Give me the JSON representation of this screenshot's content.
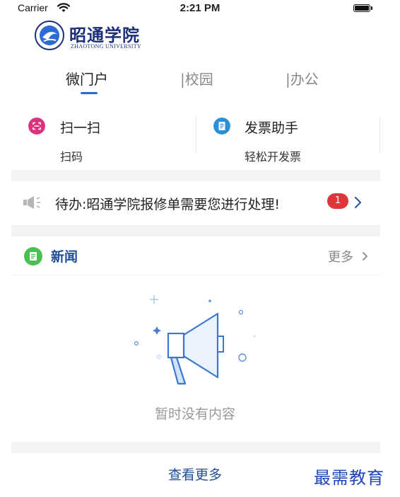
{
  "status_bar": {
    "carrier": "Carrier",
    "time": "2:21 PM"
  },
  "logo": {
    "name_cn": "昭通学院",
    "name_en": "ZHAOTONG UNIVERSITY"
  },
  "tabs": [
    {
      "label": "微门户",
      "active": true
    },
    {
      "label": "|校园",
      "active": false
    },
    {
      "label": "|办公",
      "active": false
    }
  ],
  "shortcuts": [
    {
      "title": "扫一扫",
      "subtitle": "扫码",
      "icon": "scan-icon",
      "color": "#d9337d"
    },
    {
      "title": "发票助手",
      "subtitle": "轻松开发票",
      "icon": "invoice-icon",
      "color": "#2a8fd8"
    }
  ],
  "notice": {
    "text": "待办:昭通学院报修单需要您进行处理!",
    "badge_count": "1",
    "icon": "megaphone-icon"
  },
  "news": {
    "title": "新闻",
    "more_label": "更多",
    "icon": "news-icon",
    "accent": "#4cbf52"
  },
  "empty_state": {
    "text": "暂时没有内容",
    "icon": "megaphone-illustration"
  },
  "footer": {
    "view_more_label": "查看更多"
  },
  "watermark": {
    "text": "最需教育"
  }
}
